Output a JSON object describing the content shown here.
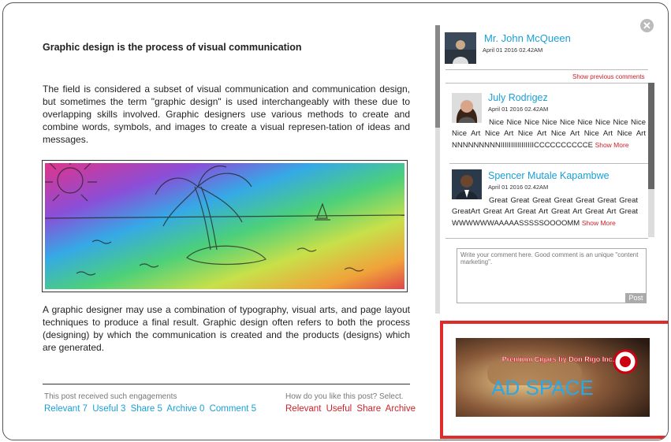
{
  "article": {
    "title": "Graphic design is the process of visual communication",
    "paragraph1": "The field is considered a subset of visual communication and communication design, but sometimes the term \"graphic design\" is used interchangeably with these due to overlapping skills involved. Graphic designers use various methods to create and combine words, symbols, and images to create a visual represen-tation of ideas and messages.",
    "paragraph2": "A graphic designer may use a combination of typography, visual arts, and page layout techniques to produce a final result. Graphic design often refers to both the process (designing) by which the communication is created and the products (designs) which are generated."
  },
  "engagement": {
    "caption": "This post received such engagements",
    "stats": [
      "Relevant 7",
      "Useful 3",
      "Share 5",
      "Archive 0",
      "Comment 5"
    ],
    "question": "How do you like this post? Select.",
    "options": [
      "Relevant",
      "Useful",
      "Share",
      "Archive"
    ]
  },
  "author": {
    "name": "Mr. John McQueen",
    "date": "April 01 2016 02.42AM"
  },
  "comments_panel": {
    "show_previous": "Show previous comments",
    "comments": [
      {
        "name": "July Rodrigez",
        "date": "April 01 2016 02.42AM",
        "text": "Nice Nice Nice Nice Nice Nice Nice Nice Nice Nice Art Nice Art Nice Art Nice Art Nice Art Nice Art NNNNNNNNNIIIIIIIIIIIIIIIICCCCCCCCCCE",
        "more": "Show More"
      },
      {
        "name": "Spencer Mutale Kapambwe",
        "date": "April 01 2016 02.42AM",
        "text": "Great Great Great Great Great Great Great GreatArt Great Art Great Art Great Art Great Art Great WWWWWWAAAAASSSSSOOOOMM",
        "more": "Show More"
      }
    ],
    "input_placeholder": "Write your comment here. Good comment is an unique \"content marketing\".",
    "post_label": "Post"
  },
  "ad": {
    "tagline": "Premium Cigars by Don Rigo Inc.",
    "label": "AD SPACE"
  },
  "colors": {
    "link_blue": "#1a9fd6",
    "accent_red": "#cc2229",
    "ad_border": "#e02b2b"
  }
}
